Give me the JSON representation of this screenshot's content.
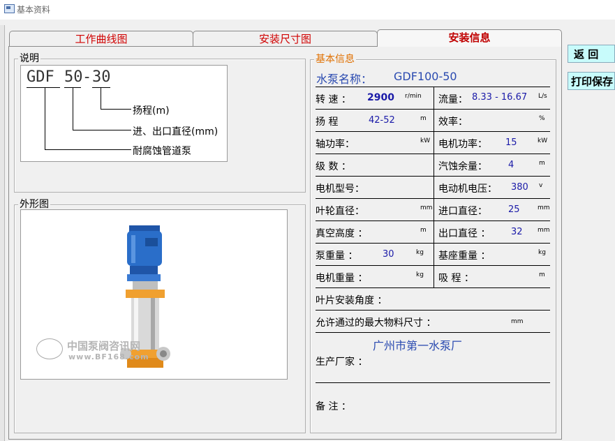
{
  "window": {
    "title": "基本资料"
  },
  "tabs": [
    {
      "label": "工作曲线图"
    },
    {
      "label": "安装尺寸图"
    },
    {
      "label": "安装信息"
    }
  ],
  "explain": {
    "group_label": "说明",
    "code_prefix": "GDF",
    "code_mid": "50",
    "code_dash": "-",
    "code_end": "30",
    "items": [
      "扬程(m)",
      "进、出口直径(mm)",
      "耐腐蚀管道泵"
    ]
  },
  "shape": {
    "group_label": "外形图",
    "watermark_text": "中国泵阀咨讯网",
    "watermark_url": "www.BF168.com"
  },
  "info": {
    "group_label": "基本信息",
    "pump_name_label": "水泵名称：",
    "pump_name": "GDF100-50",
    "rows": [
      {
        "l_label": "转 速 ：",
        "l_value": "2900",
        "l_unit": "r/min",
        "r_label": "流量：",
        "r_value": "8.33 - 16.67",
        "r_unit": "L/s"
      },
      {
        "l_label": "扬 程",
        "l_value": "42-52",
        "l_unit": "m",
        "r_label": "效率：",
        "r_value": "",
        "r_unit": "%"
      },
      {
        "l_label": "轴功率：",
        "l_value": "",
        "l_unit": "kW",
        "r_label": "电机功率：",
        "r_value": "15",
        "r_unit": "kW"
      },
      {
        "l_label": "级 数 ：",
        "l_value": "",
        "l_unit": "",
        "r_label": "汽蚀余量：",
        "r_value": "4",
        "r_unit": "m"
      },
      {
        "l_label": "电机型号：",
        "l_value": "",
        "l_unit": "",
        "r_label": "电动机电压：",
        "r_value": "380",
        "r_unit": "v"
      },
      {
        "l_label": "叶轮直径：",
        "l_value": "",
        "l_unit": "mm",
        "r_label": "进口直径：",
        "r_value": "25",
        "r_unit": "mm"
      },
      {
        "l_label": "真空高度 ：",
        "l_value": "",
        "l_unit": "m",
        "r_label": "出口直径 ：",
        "r_value": "32",
        "r_unit": "mm"
      },
      {
        "l_label": "泵重量 ：",
        "l_value": "30",
        "l_unit": "kg",
        "r_label": "基座重量 ：",
        "r_value": "",
        "r_unit": "kg"
      },
      {
        "l_label": "电机重量 ：",
        "l_value": "",
        "l_unit": "kg",
        "r_label": "吸 程 ：",
        "r_value": "",
        "r_unit": "m"
      }
    ],
    "blade_angle_label": "叶片安装角度 ：",
    "max_size_label": "允许通过的最大物料尺寸 ：",
    "max_size_unit": "mm",
    "manufacturer_value": "广州市第一水泵厂",
    "manufacturer_label": "生产厂家 ：",
    "remark_label": "备  注 ："
  },
  "side_buttons": {
    "back": "返  回",
    "print": "打印保存"
  }
}
